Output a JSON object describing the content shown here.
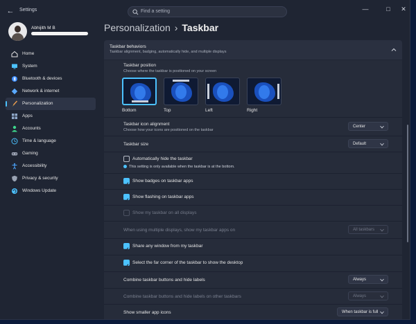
{
  "window": {
    "title": "Settings",
    "controls": [
      "—",
      "□",
      "✕"
    ]
  },
  "search": {
    "placeholder": "Find a setting"
  },
  "profile": {
    "name": "Abhijith M B"
  },
  "sidebar": {
    "items": [
      {
        "label": "Home",
        "icon": "home-icon",
        "color": "#e8e8e8"
      },
      {
        "label": "System",
        "icon": "monitor-icon",
        "color": "#4cc2ff"
      },
      {
        "label": "Bluetooth & devices",
        "icon": "bluetooth-icon",
        "color": "#3a8bff"
      },
      {
        "label": "Network & internet",
        "icon": "wifi-diamond-icon",
        "color": "#5aa9ff"
      },
      {
        "label": "Personalization",
        "icon": "brush-icon",
        "color": "#f0a050",
        "active": true
      },
      {
        "label": "Apps",
        "icon": "apps-icon",
        "color": "#8fa8c8"
      },
      {
        "label": "Accounts",
        "icon": "person-icon",
        "color": "#3dd68c"
      },
      {
        "label": "Time & language",
        "icon": "globe-clock-icon",
        "color": "#4cc2ff"
      },
      {
        "label": "Gaming",
        "icon": "gamepad-icon",
        "color": "#a0a8b8"
      },
      {
        "label": "Accessibility",
        "icon": "accessibility-icon",
        "color": "#4ca6ff"
      },
      {
        "label": "Privacy & security",
        "icon": "shield-icon",
        "color": "#9aa3b3"
      },
      {
        "label": "Windows Update",
        "icon": "update-icon",
        "color": "#4cc2ff"
      }
    ]
  },
  "breadcrumb": {
    "parent": "Personalization",
    "separator": "›",
    "current": "Taskbar"
  },
  "section": {
    "title": "Taskbar behaviors",
    "subtitle": "Taskbar alignment, badging, automatically hide, and multiple displays"
  },
  "position": {
    "label": "Taskbar position",
    "sub": "Choose where the taskbar is positioned on your screen",
    "options": [
      "Bottom",
      "Top",
      "Left",
      "Right"
    ],
    "selected": "Bottom"
  },
  "alignment": {
    "label": "Taskbar icon alignment",
    "sub": "Choose how your icons are positioned on the taskbar",
    "value": "Center"
  },
  "size": {
    "label": "Taskbar size",
    "value": "Default"
  },
  "autohide": {
    "label": "Automatically hide the taskbar",
    "checked": false,
    "info": "This setting is only available when the taskbar is at the bottom."
  },
  "badges": {
    "label": "Show badges on taskbar apps",
    "checked": true
  },
  "flashing": {
    "label": "Show flashing on taskbar apps",
    "checked": true
  },
  "all_displays": {
    "label": "Show my taskbar on all displays",
    "checked": false,
    "disabled": true
  },
  "multi_display": {
    "label": "When using multiple displays, show my taskbar apps on",
    "value": "All taskbars",
    "disabled": true
  },
  "share_window": {
    "label": "Share any window from my taskbar",
    "checked": true
  },
  "far_corner": {
    "label": "Select the far corner of the taskbar to show the desktop",
    "checked": true
  },
  "combine": {
    "label": "Combine taskbar buttons and hide labels",
    "value": "Always"
  },
  "combine_other": {
    "label": "Combine taskbar buttons and hide labels on other taskbars",
    "value": "Always",
    "disabled": true
  },
  "smaller_icons": {
    "label": "Show smaller app icons",
    "value": "When taskbar is full"
  },
  "colors": {
    "accent": "#4cc2ff",
    "window_bg": "#1f2533",
    "card_bg": "#262c3a"
  }
}
